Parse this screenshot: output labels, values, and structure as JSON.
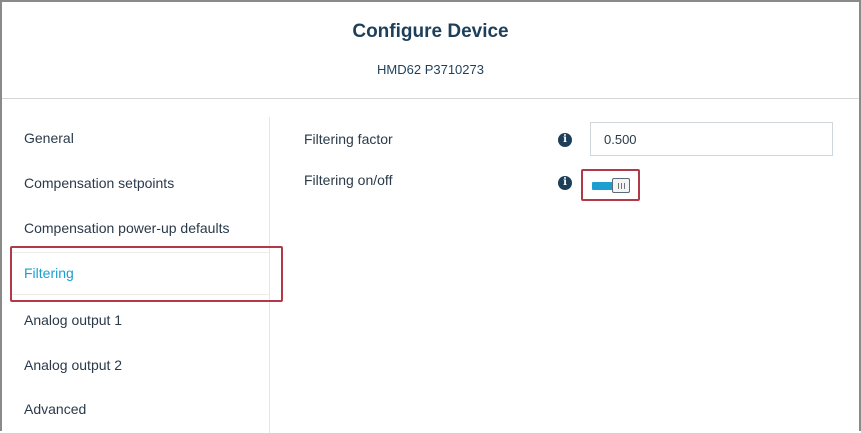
{
  "header": {
    "title": "Configure Device",
    "subtitle": "HMD62 P3710273"
  },
  "sidebar": {
    "active_index": 3,
    "items": [
      {
        "label": "General"
      },
      {
        "label": "Compensation setpoints"
      },
      {
        "label": "Compensation power-up defaults"
      },
      {
        "label": "Filtering"
      },
      {
        "label": "Analog output 1"
      },
      {
        "label": "Analog output 2"
      },
      {
        "label": "Advanced"
      }
    ]
  },
  "main": {
    "filtering_factor": {
      "label": "Filtering factor",
      "value": "0.500",
      "info_icon": "info-icon"
    },
    "filtering_toggle": {
      "label": "Filtering on/off",
      "state": "on",
      "info_icon": "info-icon"
    }
  },
  "colors": {
    "accent": "#1c9fd0",
    "highlight": "#b23a48",
    "title": "#1e3f5a"
  }
}
